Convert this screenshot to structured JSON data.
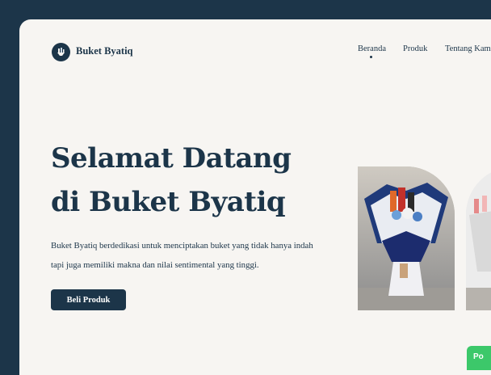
{
  "brand": {
    "name": "Buket Byatiq",
    "icon": "bouquet-logo-icon"
  },
  "nav": {
    "items": [
      {
        "label": "Beranda",
        "active": true
      },
      {
        "label": "Produk",
        "active": false
      },
      {
        "label": "Tentang Kami",
        "active": false
      }
    ]
  },
  "hero": {
    "title": "Selamat Datang\ndi Buket Byatiq",
    "description": "Buket Byatiq berdedikasi untuk menciptakan buket yang tidak hanya indah tapi juga memiliki makna dan nilai sentimental yang tinggi.",
    "cta_label": "Beli Produk"
  },
  "floating_badge": {
    "label": "Po"
  },
  "colors": {
    "primary": "#1c3549",
    "background": "#f7f5f2",
    "accent_green": "#3cc86a"
  }
}
